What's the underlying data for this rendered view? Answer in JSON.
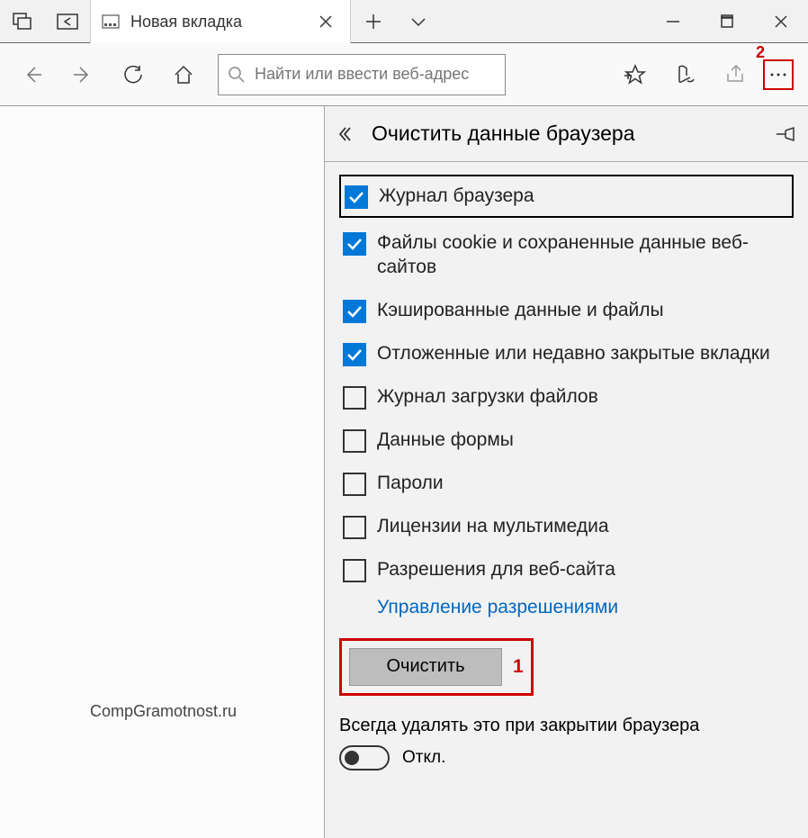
{
  "titlebar": {
    "tab_title": "Новая вкладка"
  },
  "toolbar": {
    "search_placeholder": "Найти или ввести веб-адрес",
    "annot2": "2"
  },
  "panel": {
    "title": "Очистить данные браузера",
    "items": [
      {
        "label": "Журнал браузера",
        "checked": true,
        "highlighted": true
      },
      {
        "label": "Файлы cookie и сохраненные данные веб-сайтов",
        "checked": true
      },
      {
        "label": "Кэшированные данные и файлы",
        "checked": true
      },
      {
        "label": "Отложенные или недавно закрытые вкладки",
        "checked": true
      },
      {
        "label": "Журнал загрузки файлов",
        "checked": false
      },
      {
        "label": "Данные формы",
        "checked": false
      },
      {
        "label": "Пароли",
        "checked": false
      },
      {
        "label": "Лицензии на мультимедиа",
        "checked": false
      },
      {
        "label": "Разрешения для веб-сайта",
        "checked": false
      }
    ],
    "permissions_link": "Управление разрешениями",
    "clear_button": "Очистить",
    "annot1": "1",
    "always_label": "Всегда удалять это при закрытии браузера",
    "toggle_label": "Откл."
  },
  "watermark": "CompGramotnost.ru"
}
